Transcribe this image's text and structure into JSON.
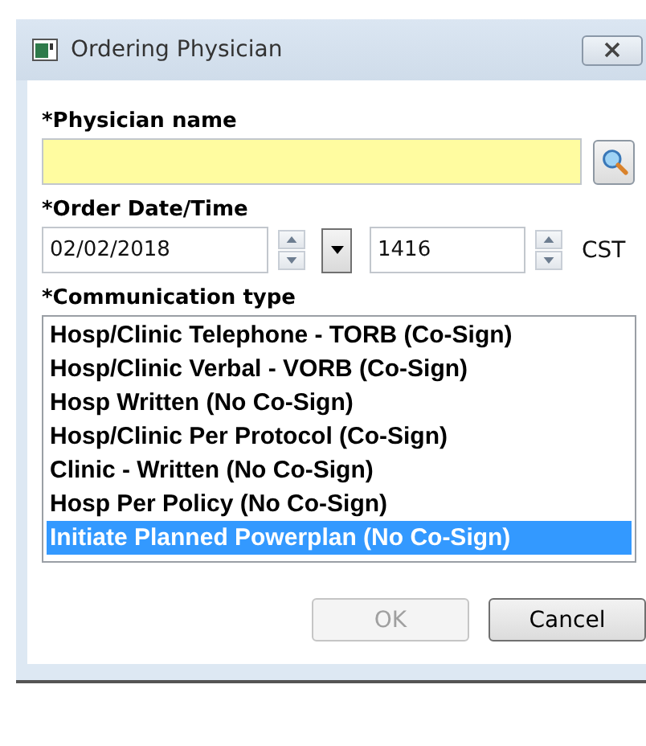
{
  "window": {
    "title": "Ordering Physician"
  },
  "physician": {
    "label": "*Physician name"
  },
  "order_datetime": {
    "label": "*Order Date/Time",
    "date": "02/02/2018",
    "time": "1416",
    "timezone": "CST"
  },
  "communication": {
    "label": "*Communication type",
    "items": [
      {
        "label": "Hosp/Clinic Telephone - TORB (Co-Sign)",
        "selected": false
      },
      {
        "label": "Hosp/Clinic Verbal - VORB (Co-Sign)",
        "selected": false
      },
      {
        "label": "Hosp Written (No Co-Sign)",
        "selected": false
      },
      {
        "label": "Hosp/Clinic Per Protocol (Co-Sign)",
        "selected": false
      },
      {
        "label": "Clinic - Written (No Co-Sign)",
        "selected": false
      },
      {
        "label": "Hosp Per Policy (No Co-Sign)",
        "selected": false
      },
      {
        "label": "Initiate Planned Powerplan (No Co-Sign)",
        "selected": true
      }
    ]
  },
  "buttons": [
    {
      "label": "OK",
      "disabled": true
    },
    {
      "label": "Cancel",
      "disabled": false
    }
  ]
}
